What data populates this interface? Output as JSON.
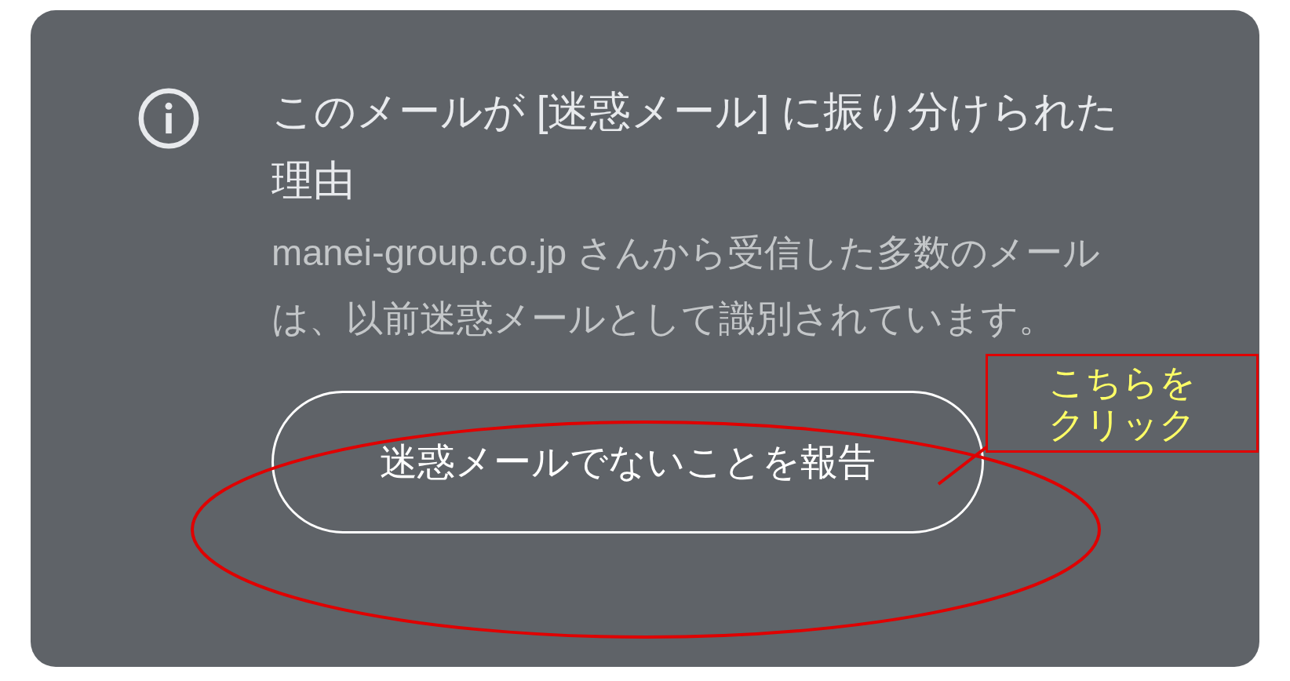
{
  "notice": {
    "title": "このメールが [迷惑メール] に振り分けられた理由",
    "message": "manei-group.co.jp さんから受信した多数のメールは、以前迷惑メールとして識別されています。",
    "button": "迷惑メールでないことを報告"
  },
  "annotation": {
    "text": "こちらをクリック"
  }
}
